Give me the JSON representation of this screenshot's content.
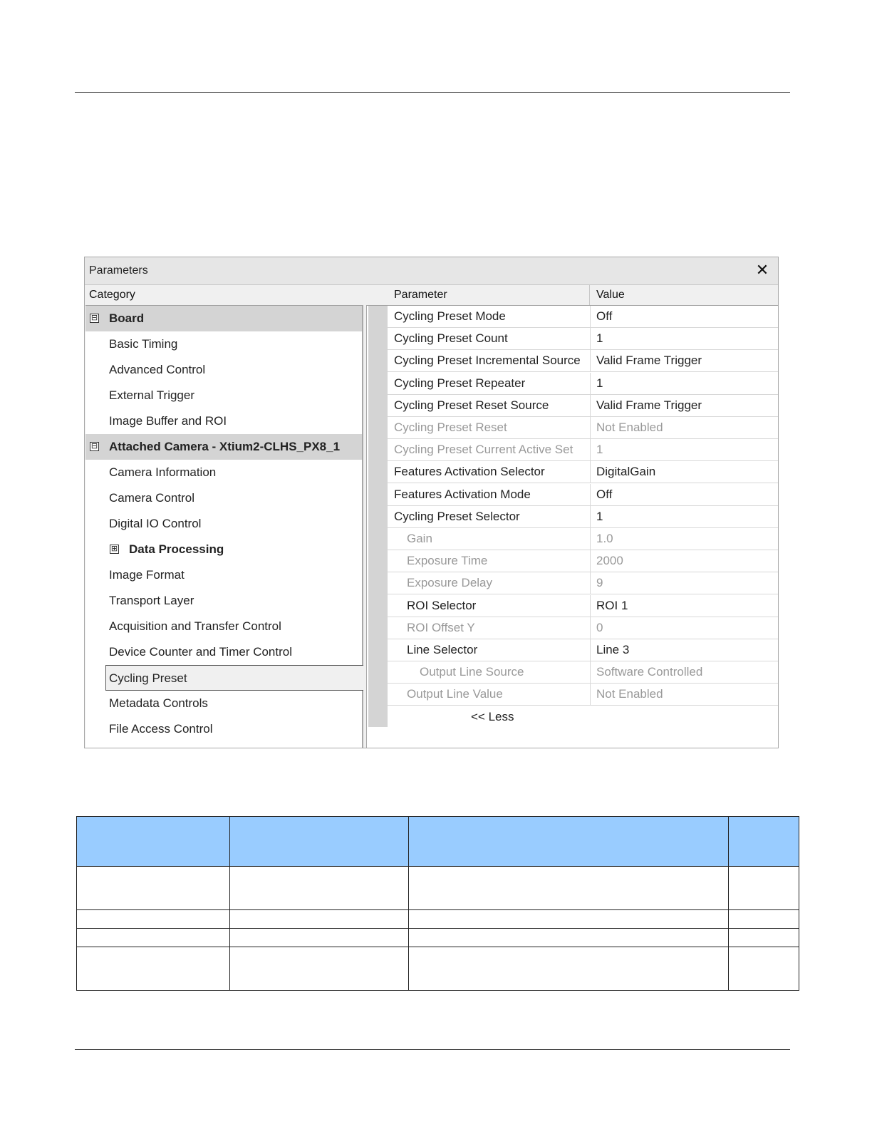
{
  "window": {
    "title": "Parameters",
    "close_icon": "close-icon",
    "category_header": "Category",
    "parameter_header": "Parameter",
    "value_header": "Value"
  },
  "tree": {
    "items": [
      {
        "label": "Board",
        "kind": "group",
        "expander": "⊟"
      },
      {
        "label": "Basic Timing",
        "kind": "leaf"
      },
      {
        "label": "Advanced Control",
        "kind": "leaf"
      },
      {
        "label": "External Trigger",
        "kind": "leaf"
      },
      {
        "label": "Image Buffer and ROI",
        "kind": "leaf"
      },
      {
        "label": "Attached Camera - Xtium2-CLHS_PX8_1",
        "kind": "group",
        "expander": "⊟"
      },
      {
        "label": "Camera Information",
        "kind": "leaf"
      },
      {
        "label": "Camera Control",
        "kind": "leaf"
      },
      {
        "label": "Digital IO Control",
        "kind": "leaf"
      },
      {
        "label": "Data Processing",
        "kind": "sub",
        "expander": "⊞"
      },
      {
        "label": "Image Format",
        "kind": "leaf"
      },
      {
        "label": "Transport Layer",
        "kind": "leaf"
      },
      {
        "label": "Acquisition and Transfer Control",
        "kind": "leaf"
      },
      {
        "label": "Device Counter and Timer Control",
        "kind": "leaf"
      },
      {
        "label": "Cycling Preset",
        "kind": "selected"
      },
      {
        "label": "Metadata Controls",
        "kind": "leaf"
      },
      {
        "label": "File Access Control",
        "kind": "leaf"
      }
    ]
  },
  "grid": {
    "rows": [
      {
        "parameter": "Cycling Preset Mode",
        "value": "Off",
        "enabled": true,
        "indent": 0
      },
      {
        "parameter": "Cycling Preset Count",
        "value": "1",
        "enabled": true,
        "indent": 0
      },
      {
        "parameter": "Cycling Preset Incremental Source",
        "value": "Valid Frame Trigger",
        "enabled": true,
        "indent": 0
      },
      {
        "parameter": "Cycling Preset Repeater",
        "value": "1",
        "enabled": true,
        "indent": 0
      },
      {
        "parameter": "Cycling Preset Reset Source",
        "value": "Valid Frame Trigger",
        "enabled": true,
        "indent": 0
      },
      {
        "parameter": "Cycling Preset Reset",
        "value": "Not Enabled",
        "enabled": false,
        "indent": 0
      },
      {
        "parameter": "Cycling Preset Current Active Set",
        "value": "1",
        "enabled": false,
        "indent": 0
      },
      {
        "parameter": "Features Activation Selector",
        "value": "DigitalGain",
        "enabled": true,
        "indent": 0
      },
      {
        "parameter": "Features Activation Mode",
        "value": "Off",
        "enabled": true,
        "indent": 0
      },
      {
        "parameter": "Cycling Preset Selector",
        "value": "1",
        "enabled": true,
        "indent": 0
      },
      {
        "parameter": "Gain",
        "value": "1.0",
        "enabled": false,
        "indent": 1
      },
      {
        "parameter": "Exposure Time",
        "value": "2000",
        "enabled": false,
        "indent": 1
      },
      {
        "parameter": "Exposure Delay",
        "value": "9",
        "enabled": false,
        "indent": 1
      },
      {
        "parameter": "ROI Selector",
        "value": "ROI 1",
        "enabled": true,
        "indent": 1
      },
      {
        "parameter": "ROI Offset Y",
        "value": "0",
        "enabled": false,
        "indent": 1
      },
      {
        "parameter": "Line Selector",
        "value": "Line 3",
        "enabled": true,
        "indent": 1
      },
      {
        "parameter": "Output Line Source",
        "value": "Software Controlled",
        "enabled": false,
        "indent": 2
      },
      {
        "parameter": "Output Line Value",
        "value": "Not Enabled",
        "enabled": false,
        "indent": 1
      }
    ],
    "less_label": "<< Less"
  },
  "table": {
    "rows": 5,
    "columns": 4
  }
}
